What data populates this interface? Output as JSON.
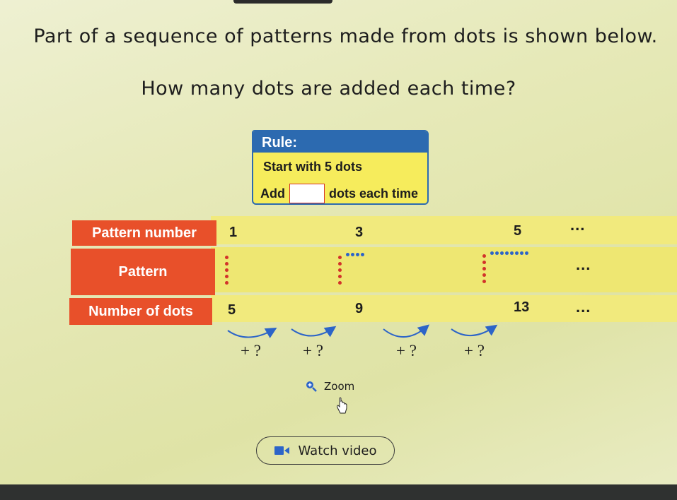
{
  "question": {
    "line1": "Part of a sequence of patterns made from dots is shown below.",
    "line2": "How many dots are added each time?"
  },
  "rule_box": {
    "title": "Rule:",
    "line1": "Start with 5 dots",
    "line2_before": "Add",
    "line2_after": "dots each time",
    "answer_value": ""
  },
  "table": {
    "row_labels": [
      "Pattern number",
      "Pattern",
      "Number of dots"
    ],
    "pattern_numbers": [
      "1",
      "3",
      "5"
    ],
    "dot_counts": [
      "5",
      "9",
      "13"
    ],
    "ellipsis": "..."
  },
  "increments": [
    "+ ?",
    "+ ?",
    "+ ?",
    "+ ?"
  ],
  "zoom_label": "Zoom",
  "watch_video_label": "Watch video",
  "colors": {
    "header_orange": "#e8502a",
    "rule_blue": "#2c6ab0",
    "rule_yellow": "#f6ec5c",
    "dot_blue": "#2c64c8",
    "dot_red": "#d2332a"
  }
}
